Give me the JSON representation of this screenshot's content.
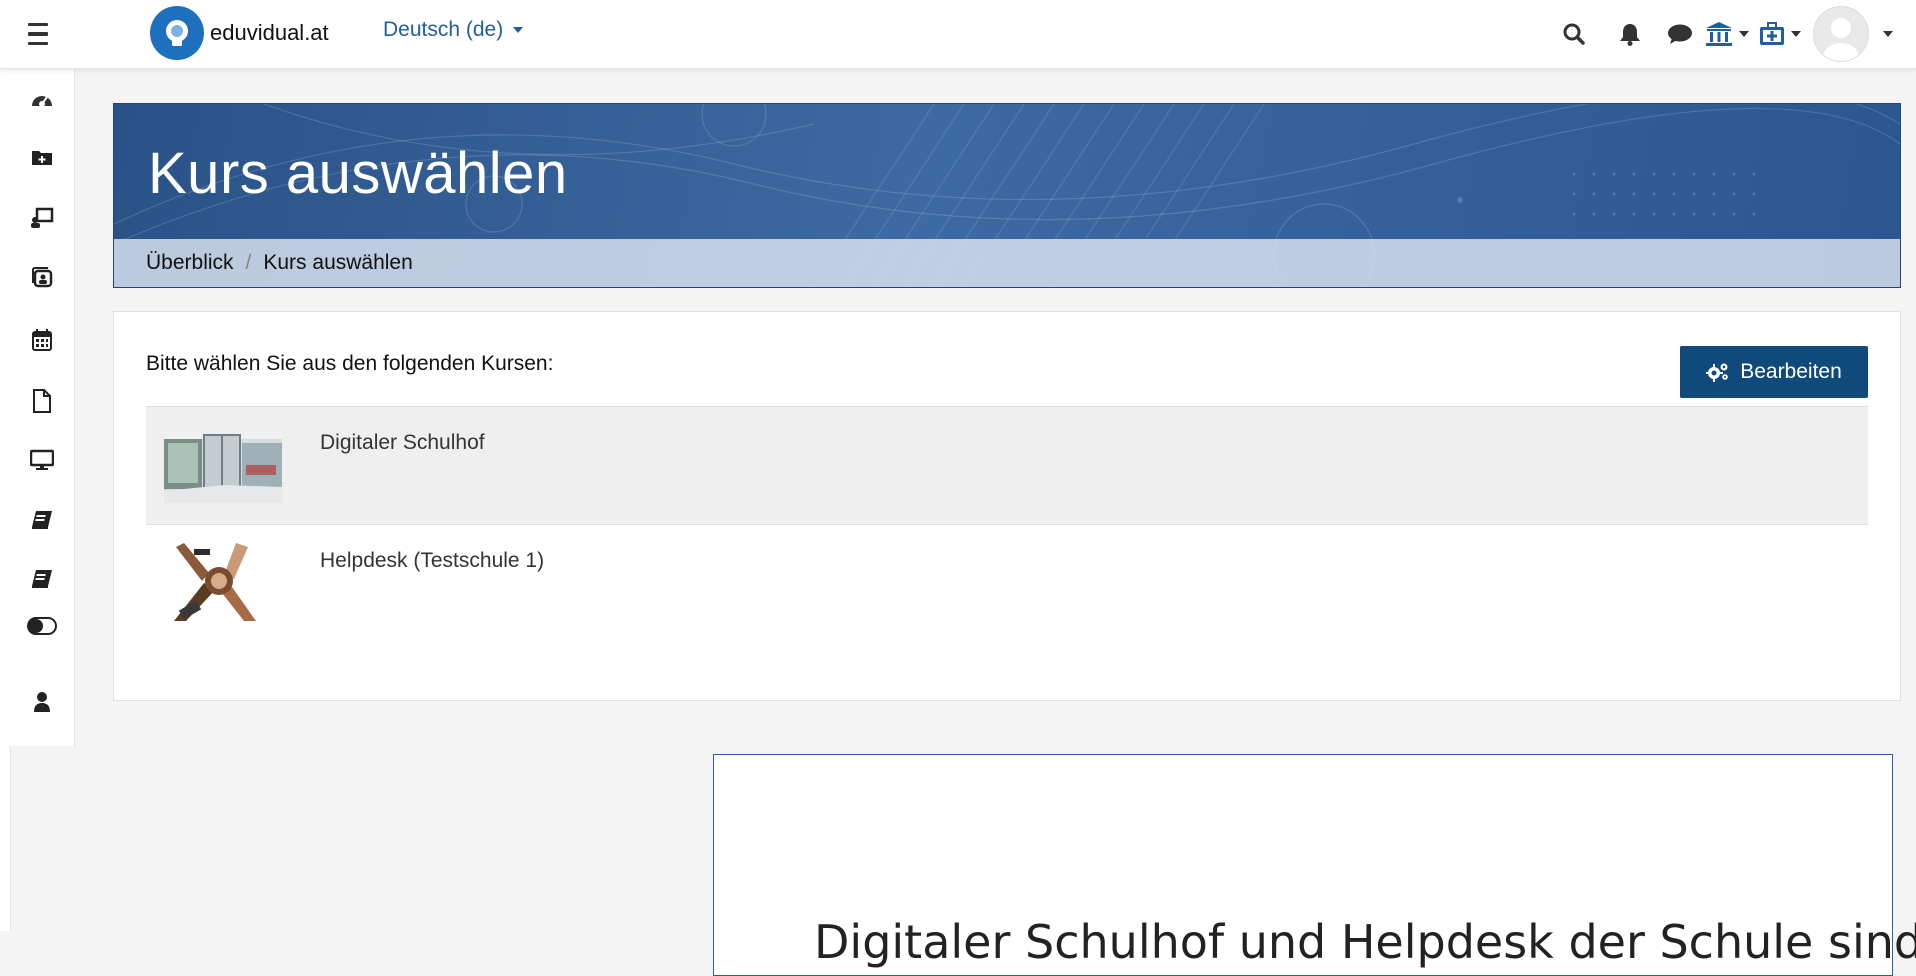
{
  "navbar": {
    "brand": "eduvidual.at",
    "language": "Deutsch (de)"
  },
  "sidebar": {
    "items": [
      "dashboard-icon",
      "folder-plus-icon",
      "teacher-board-icon",
      "webinar-icon",
      "calendar-icon",
      "file-icon",
      "desktop-icon",
      "book-icon",
      "book-icon",
      "toggle-icon",
      "user-icon"
    ]
  },
  "header": {
    "title": "Kurs auswählen",
    "breadcrumb": [
      "Überblick",
      "Kurs auswählen"
    ]
  },
  "main": {
    "intro": "Bitte wählen Sie aus den folgenden Kursen:",
    "edit_label": "Bearbeiten",
    "courses": [
      {
        "name": "Digitaler Schulhof"
      },
      {
        "name": "Helpdesk (Testschule 1)"
      }
    ]
  },
  "overlay": {
    "text": "Digitaler Schulhof und Helpdesk der Schule sind"
  },
  "colors": {
    "brand_blue": "#1f6fbf",
    "banner_blue": "#2f5b93",
    "button_blue": "#0f4a7a"
  }
}
